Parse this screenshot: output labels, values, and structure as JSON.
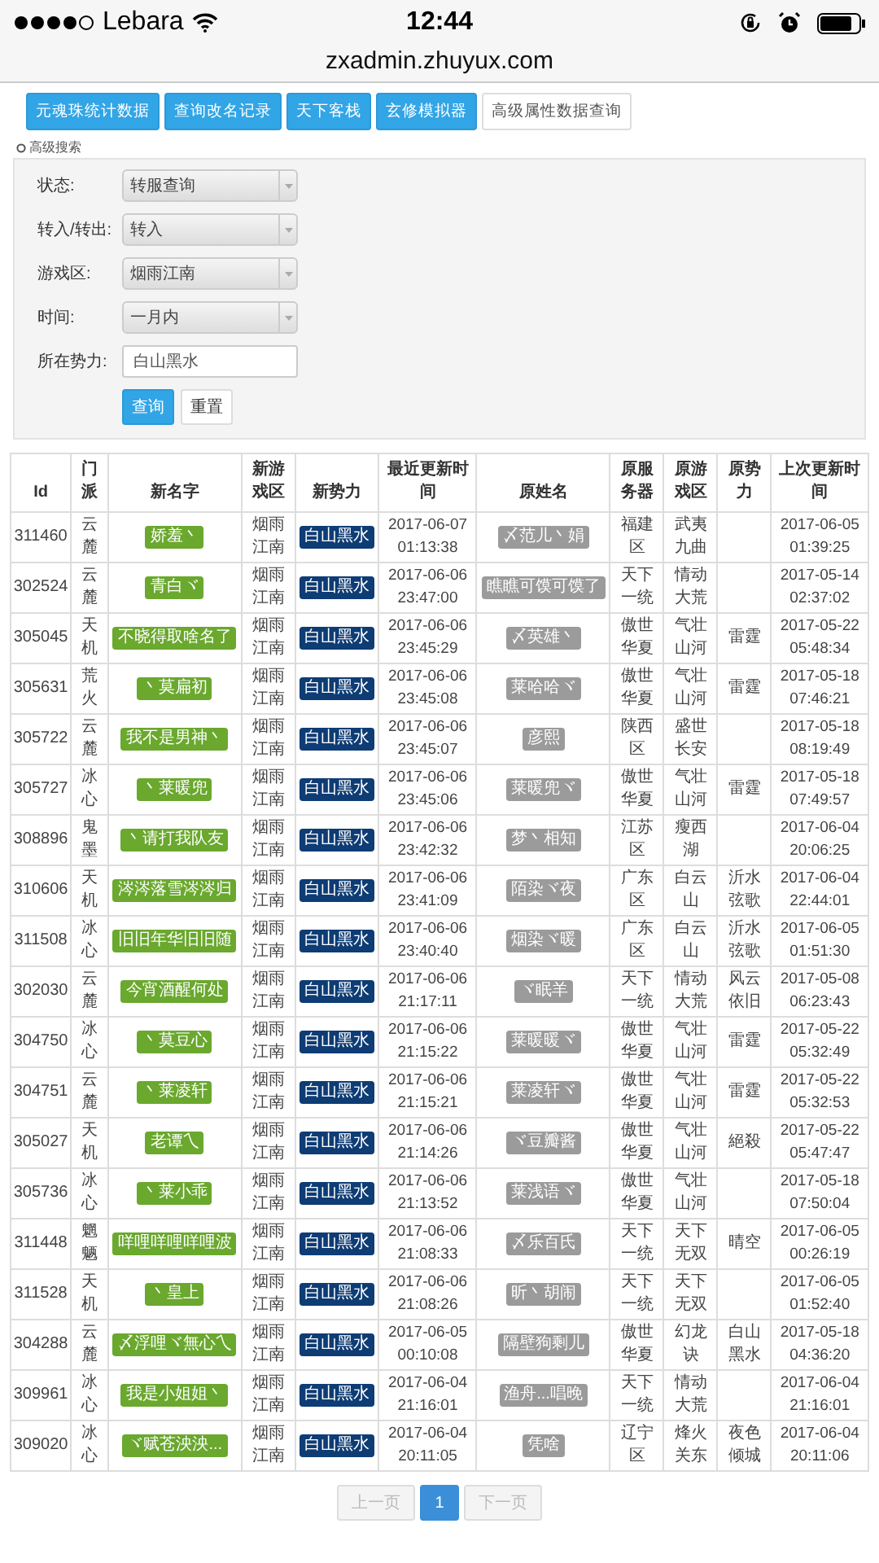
{
  "status_bar": {
    "carrier": "Lebara",
    "time": "12:44",
    "url": "zxadmin.zhuyux.com"
  },
  "tabs": [
    {
      "label": "元魂珠统计数据",
      "selected": false
    },
    {
      "label": "查询改名记录",
      "selected": false
    },
    {
      "label": "天下客栈",
      "selected": false
    },
    {
      "label": "玄修模拟器",
      "selected": false
    },
    {
      "label": "高级属性数据查询",
      "selected": true
    }
  ],
  "search": {
    "legend": "高级搜索",
    "fields": [
      {
        "kind": "select",
        "label": "状态:",
        "value": "转服查询"
      },
      {
        "kind": "select",
        "label": "转入/转出:",
        "value": "转入"
      },
      {
        "kind": "select",
        "label": "游戏区:",
        "value": "烟雨江南"
      },
      {
        "kind": "select",
        "label": "时间:",
        "value": "一月内"
      },
      {
        "kind": "input",
        "label": "所在势力:",
        "value": "白山黑水"
      }
    ],
    "buttons": [
      {
        "label": "查询",
        "primary": true
      },
      {
        "label": "重置",
        "primary": false
      }
    ]
  },
  "table": {
    "columns": [
      "Id",
      "门派",
      "新名字",
      "新游戏区",
      "新势力",
      "最近更新时间",
      "原姓名",
      "原服务器",
      "原游戏区",
      "原势力",
      "上次更新时间"
    ],
    "rows": [
      [
        "311460",
        "云麓",
        "娇羞丶",
        "烟雨江南",
        "白山黑水",
        "2017-06-07 01:13:38",
        "〆范儿丶娟",
        "福建区",
        "武夷九曲",
        "",
        "2017-06-05 01:39:25"
      ],
      [
        "302524",
        "云麓",
        "青白ヾ",
        "烟雨江南",
        "白山黑水",
        "2017-06-06 23:47:00",
        "瞧瞧可馍可馍了",
        "天下一统",
        "情动大荒",
        "",
        "2017-05-14 02:37:02"
      ],
      [
        "305045",
        "天机",
        "不晓得取啥名了",
        "烟雨江南",
        "白山黑水",
        "2017-06-06 23:45:29",
        "〆英雄丶",
        "傲世华夏",
        "气壮山河",
        "雷霆",
        "2017-05-22 05:48:34"
      ],
      [
        "305631",
        "荒火",
        "丶莫扁初",
        "烟雨江南",
        "白山黑水",
        "2017-06-06 23:45:08",
        "莱哈哈ヾ",
        "傲世华夏",
        "气壮山河",
        "雷霆",
        "2017-05-18 07:46:21"
      ],
      [
        "305722",
        "云麓",
        "我不是男神丶",
        "烟雨江南",
        "白山黑水",
        "2017-06-06 23:45:07",
        "彦熙",
        "陕西区",
        "盛世长安",
        "",
        "2017-05-18 08:19:49"
      ],
      [
        "305727",
        "冰心",
        "丶莱暖兜",
        "烟雨江南",
        "白山黑水",
        "2017-06-06 23:45:06",
        "莱暖兜ヾ",
        "傲世华夏",
        "气壮山河",
        "雷霆",
        "2017-05-18 07:49:57"
      ],
      [
        "308896",
        "鬼墨",
        "丶请打我队友",
        "烟雨江南",
        "白山黑水",
        "2017-06-06 23:42:32",
        "梦丶相知",
        "江苏区",
        "瘦西湖",
        "",
        "2017-06-04 20:06:25"
      ],
      [
        "310606",
        "天机",
        "涔涔落雪涔涔归",
        "烟雨江南",
        "白山黑水",
        "2017-06-06 23:41:09",
        "陌染ヾ夜",
        "广东区",
        "白云山",
        "沂水弦歌",
        "2017-06-04 22:44:01"
      ],
      [
        "311508",
        "冰心",
        "旧旧年华旧旧随",
        "烟雨江南",
        "白山黑水",
        "2017-06-06 23:40:40",
        "烟染ヾ暖",
        "广东区",
        "白云山",
        "沂水弦歌",
        "2017-06-05 01:51:30"
      ],
      [
        "302030",
        "云麓",
        "今宵酒醒何处",
        "烟雨江南",
        "白山黑水",
        "2017-06-06 21:17:11",
        "ヾ眠羊",
        "天下一统",
        "情动大荒",
        "风云依旧",
        "2017-05-08 06:23:43"
      ],
      [
        "304750",
        "冰心",
        "丶莫豆心",
        "烟雨江南",
        "白山黑水",
        "2017-06-06 21:15:22",
        "莱暖暖ヾ",
        "傲世华夏",
        "气壮山河",
        "雷霆",
        "2017-05-22 05:32:49"
      ],
      [
        "304751",
        "云麓",
        "丶莱凌轩",
        "烟雨江南",
        "白山黑水",
        "2017-06-06 21:15:21",
        "莱凌轩ヾ",
        "傲世华夏",
        "气壮山河",
        "雷霆",
        "2017-05-22 05:32:53"
      ],
      [
        "305027",
        "天机",
        "老谭乀",
        "烟雨江南",
        "白山黑水",
        "2017-06-06 21:14:26",
        "ヾ豆瓣酱",
        "傲世华夏",
        "气壮山河",
        "絕殺",
        "2017-05-22 05:47:47"
      ],
      [
        "305736",
        "冰心",
        "丶莱小乖",
        "烟雨江南",
        "白山黑水",
        "2017-06-06 21:13:52",
        "莱浅语ヾ",
        "傲世华夏",
        "气壮山河",
        "",
        "2017-05-18 07:50:04"
      ],
      [
        "311448",
        "魍魉",
        "咩哩咩哩咩哩波",
        "烟雨江南",
        "白山黑水",
        "2017-06-06 21:08:33",
        "〆乐百氏",
        "天下一统",
        "天下无双",
        "晴空",
        "2017-06-05 00:26:19"
      ],
      [
        "311528",
        "天机",
        "丶皇上",
        "烟雨江南",
        "白山黑水",
        "2017-06-06 21:08:26",
        "昕丶胡闹",
        "天下一统",
        "天下无双",
        "",
        "2017-06-05 01:52:40"
      ],
      [
        "304288",
        "云麓",
        "〆浮哩ヾ無心乀",
        "烟雨江南",
        "白山黑水",
        "2017-06-05 00:10:08",
        "隔壁狗剩儿",
        "傲世华夏",
        "幻龙诀",
        "白山黑水",
        "2017-05-18 04:36:20"
      ],
      [
        "309961",
        "冰心",
        "我是小姐姐丶",
        "烟雨江南",
        "白山黑水",
        "2017-06-04 21:16:01",
        "渔舟...唱晚",
        "天下一统",
        "情动大荒",
        "",
        "2017-06-04 21:16:01"
      ],
      [
        "309020",
        "冰心",
        "ヾ赋苍泱泱...",
        "烟雨江南",
        "白山黑水",
        "2017-06-04 20:11:05",
        "凭啥",
        "辽宁区",
        "烽火关东",
        "夜色倾城",
        "2017-06-04 20:11:06"
      ]
    ]
  },
  "pagination": [
    {
      "label": "上一页",
      "selected": false,
      "disabled": true
    },
    {
      "label": "1",
      "selected": true,
      "disabled": false
    },
    {
      "label": "下一页",
      "selected": false,
      "disabled": true
    }
  ]
}
